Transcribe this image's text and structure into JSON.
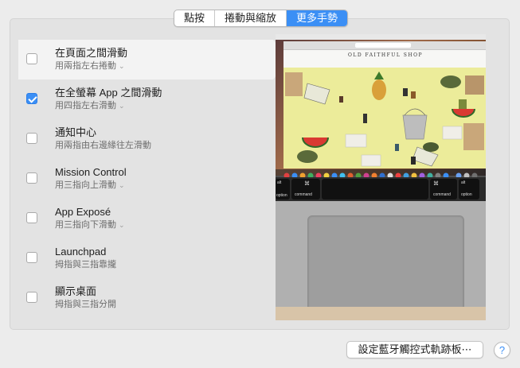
{
  "tabs": [
    {
      "label": "點按",
      "active": false
    },
    {
      "label": "捲動與縮放",
      "active": false
    },
    {
      "label": "更多手勢",
      "active": true
    }
  ],
  "gestures": [
    {
      "title": "在頁面之間滑動",
      "subtitle": "用兩指左右捲動",
      "checked": false,
      "selected": true,
      "has_dropdown": true
    },
    {
      "title": "在全螢幕 App 之間滑動",
      "subtitle": "用四指左右滑動",
      "checked": true,
      "selected": false,
      "has_dropdown": true
    },
    {
      "title": "通知中心",
      "subtitle": "用兩指由右邊緣往左滑動",
      "checked": false,
      "selected": false,
      "has_dropdown": false
    },
    {
      "title": "Mission Control",
      "subtitle": "用三指向上滑動",
      "checked": false,
      "selected": false,
      "has_dropdown": true
    },
    {
      "title": "App Exposé",
      "subtitle": "用三指向下滑動",
      "checked": false,
      "selected": false,
      "has_dropdown": true
    },
    {
      "title": "Launchpad",
      "subtitle": "拇指與三指靠攏",
      "checked": false,
      "selected": false,
      "has_dropdown": false
    },
    {
      "title": "顯示桌面",
      "subtitle": "拇指與三指分開",
      "checked": false,
      "selected": false,
      "has_dropdown": false
    }
  ],
  "preview": {
    "shop_name": "OLD FAITHFUL SHOP",
    "keys": {
      "left_symbol": "⌘",
      "left_label": "command",
      "right_symbol": "⌘",
      "right_label": "command",
      "option_left": "option",
      "option_right": "option",
      "alt_left": "alt",
      "alt_right": "alt"
    }
  },
  "footer": {
    "bluetooth_button": "設定藍牙觸控式軌跡板⋯",
    "help_label": "?"
  },
  "colors": {
    "accent": "#3b8ff5",
    "panel": "#e3e3e3",
    "window_bg": "#ececec"
  }
}
